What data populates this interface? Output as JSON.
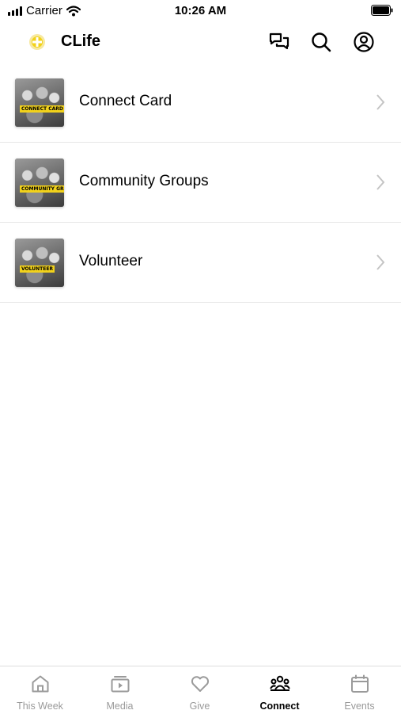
{
  "status_bar": {
    "carrier": "Carrier",
    "time": "10:26 AM"
  },
  "header": {
    "title": "CLife",
    "logo_icon": "clife-logo-icon",
    "accent": "#f2d21b"
  },
  "list": {
    "items": [
      {
        "label": "Connect Card",
        "thumb_tag": "CONNECT CARD"
      },
      {
        "label": "Community Groups",
        "thumb_tag": "COMMUNITY GROUPS"
      },
      {
        "label": "Volunteer",
        "thumb_tag": "VOLUNTEER"
      }
    ]
  },
  "tabbar": {
    "tabs": [
      {
        "label": "This Week",
        "icon": "home-icon"
      },
      {
        "label": "Media",
        "icon": "media-icon"
      },
      {
        "label": "Give",
        "icon": "heart-icon"
      },
      {
        "label": "Connect",
        "icon": "people-icon",
        "active": true
      },
      {
        "label": "Events",
        "icon": "calendar-icon"
      }
    ]
  }
}
